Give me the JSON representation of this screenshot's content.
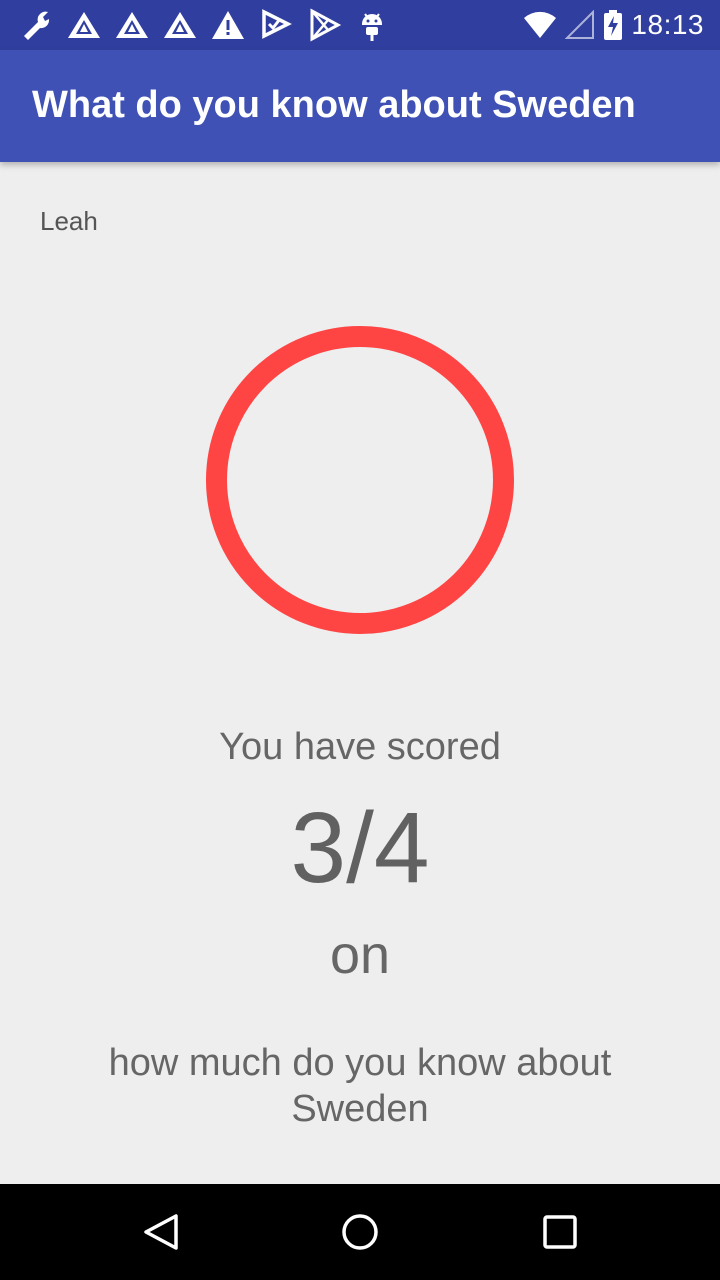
{
  "status_bar": {
    "time": "18:13",
    "left_icons": [
      "wrench-icon",
      "triangle-logo-icon",
      "triangle-logo-icon",
      "triangle-logo-icon",
      "warning-icon",
      "check-flag-icon",
      "play-store-icon",
      "android-icon"
    ],
    "right_icons": [
      "wifi-icon",
      "cell-signal-icon",
      "battery-charging-icon"
    ]
  },
  "app_bar": {
    "title": "What do you know about Sweden"
  },
  "user": {
    "name": "Leah"
  },
  "result": {
    "ring_color": "#ff4444",
    "score_label": "You have scored",
    "score": "3/4",
    "on_label": "on",
    "quiz_name": "how much do you know about Sweden"
  },
  "nav_bar": {
    "buttons": [
      "back-icon",
      "home-icon",
      "recents-icon"
    ]
  }
}
